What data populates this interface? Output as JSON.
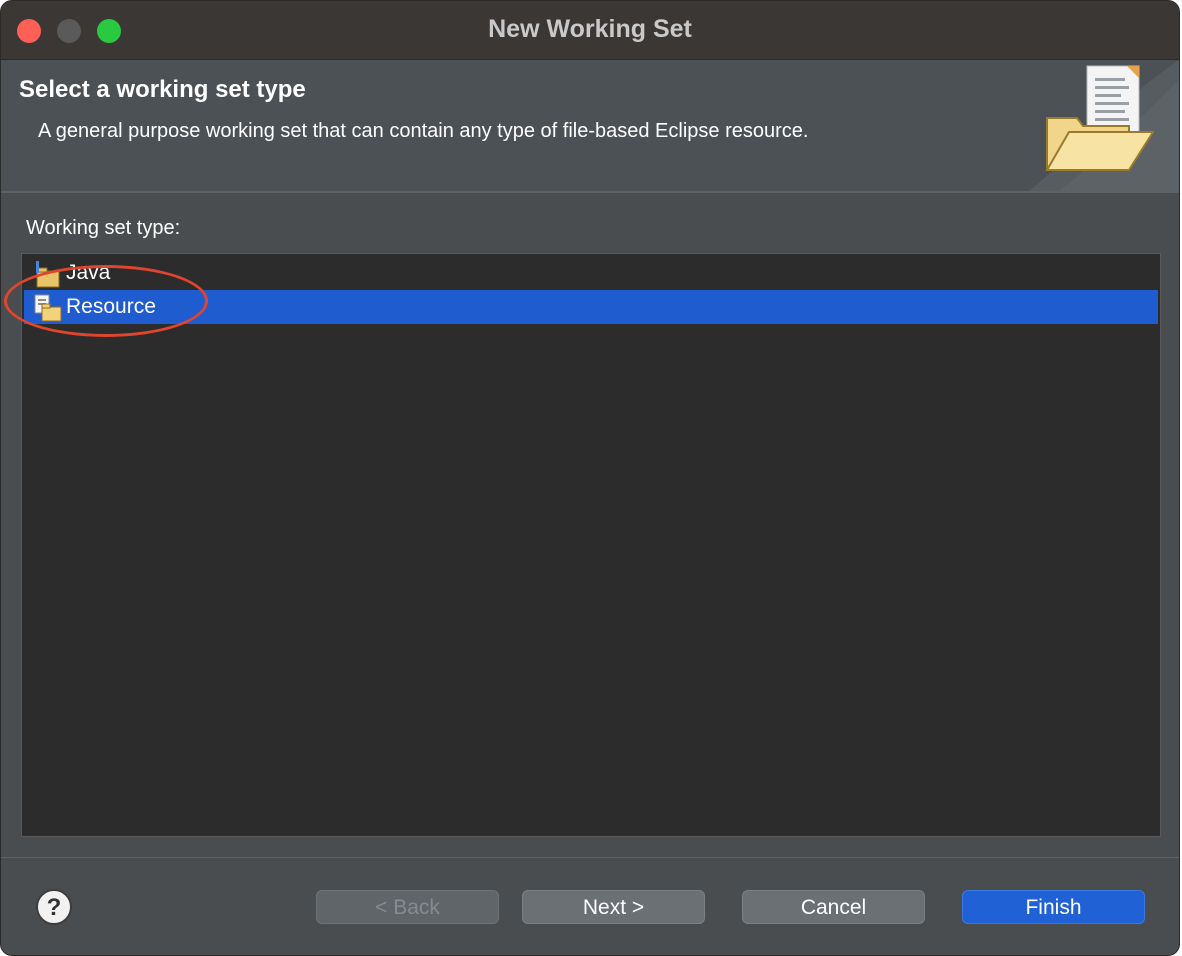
{
  "window": {
    "title": "New Working Set"
  },
  "header": {
    "title": "Select a working set type",
    "description": "A general purpose working set that can contain any type of file-based Eclipse resource."
  },
  "list": {
    "label": "Working set type:",
    "items": [
      {
        "label": "Java",
        "icon": "java-folder-icon",
        "selected": false
      },
      {
        "label": "Resource",
        "icon": "resource-folder-icon",
        "selected": true
      }
    ]
  },
  "buttons": {
    "back": "< Back",
    "next": "Next >",
    "cancel": "Cancel",
    "finish": "Finish",
    "back_enabled": false
  },
  "colors": {
    "selection": "#1f5ccf",
    "accent_button": "#2062d6",
    "annotation": "#e0452e"
  }
}
